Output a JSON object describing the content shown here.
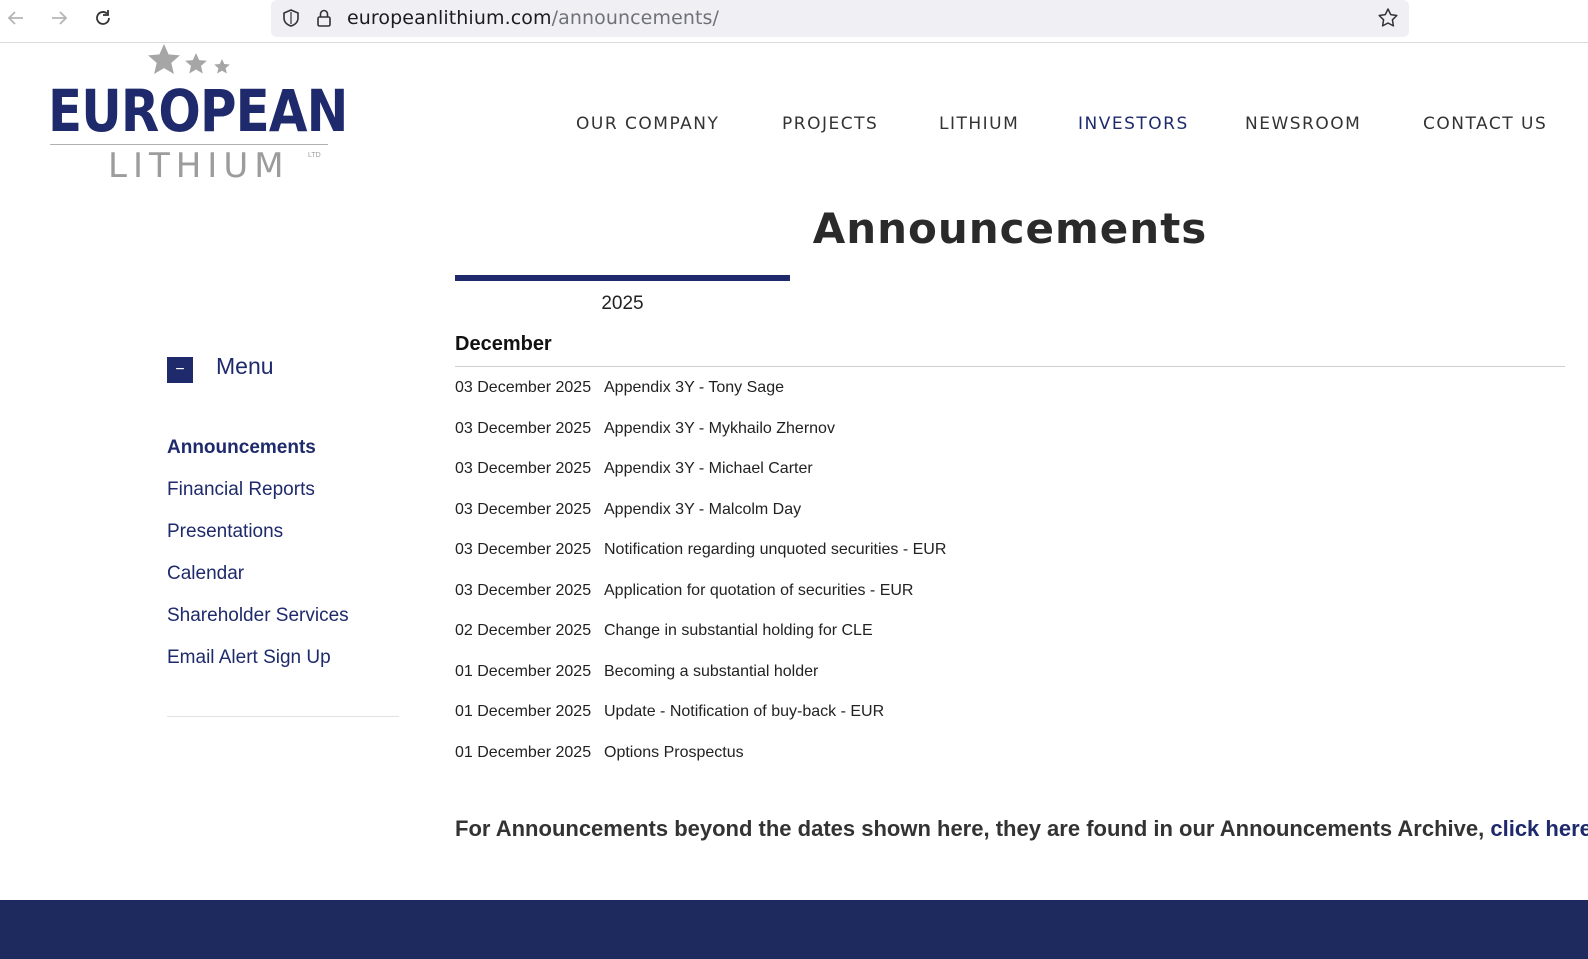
{
  "browser": {
    "url_host": "europeanlithium.com",
    "url_path": "/announcements/"
  },
  "logo": {
    "line1": "EUROPEAN",
    "line2": "LITHIUM",
    "suffix": "LTD"
  },
  "nav": {
    "items": [
      "OUR COMPANY",
      "PROJECTS",
      "LITHIUM",
      "INVESTORS",
      "NEWSROOM",
      "CONTACT US"
    ],
    "active": "INVESTORS"
  },
  "page": {
    "title": "Announcements",
    "year_tab": "2025",
    "month": "December"
  },
  "sidebar": {
    "menu_toggle": "−",
    "menu_label": "Menu",
    "links": [
      "Announcements",
      "Financial Reports",
      "Presentations",
      "Calendar",
      "Shareholder Services",
      "Email Alert Sign Up"
    ],
    "active": "Announcements"
  },
  "announcements": [
    {
      "date": "03 December 2025",
      "title": "Appendix 3Y - Tony Sage"
    },
    {
      "date": "03 December 2025",
      "title": "Appendix 3Y - Mykhailo Zhernov"
    },
    {
      "date": "03 December 2025",
      "title": "Appendix 3Y - Michael Carter"
    },
    {
      "date": "03 December 2025",
      "title": "Appendix 3Y - Malcolm Day"
    },
    {
      "date": "03 December 2025",
      "title": "Notification regarding unquoted securities - EUR"
    },
    {
      "date": "03 December 2025",
      "title": "Application for quotation of securities - EUR"
    },
    {
      "date": "02 December 2025",
      "title": "Change in substantial holding for CLE"
    },
    {
      "date": "01 December 2025",
      "title": "Becoming a substantial holder"
    },
    {
      "date": "01 December 2025",
      "title": "Update - Notification of buy-back - EUR"
    },
    {
      "date": "01 December 2025",
      "title": "Options Prospectus"
    }
  ],
  "archive": {
    "text": "For Announcements beyond the dates shown here, they are found in our Announcements Archive, ",
    "link": "click here."
  },
  "colors": {
    "brand_navy": "#1e2a6b",
    "footer": "#1e2a5e",
    "logo_grey": "#9c9c9c"
  }
}
